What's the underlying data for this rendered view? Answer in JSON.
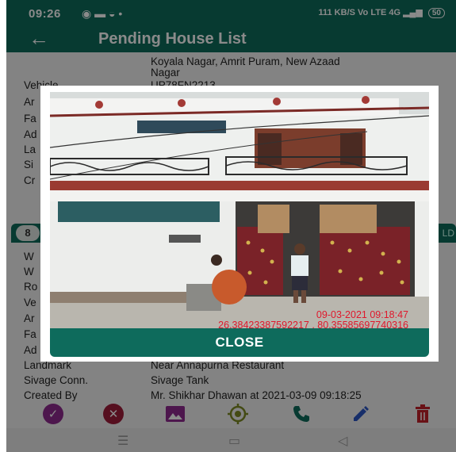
{
  "status_bar": {
    "time": "09:26",
    "net_speed": "111 KB/S",
    "network": "Vo LTE 4G",
    "battery": "50"
  },
  "app_bar": {
    "title": "Pending House List"
  },
  "record_top": {
    "address_lines": [
      "Koyala Nagar, Amrit Puram, New Azaad",
      "Nagar"
    ],
    "vehicle_label": "Vehicle",
    "vehicle_value": "UP78FN2213",
    "partial_labels": [
      "Ar",
      "Fa",
      "Ad",
      "La",
      "Si",
      "Cr"
    ]
  },
  "card": {
    "number": "8",
    "status_fragment": "LD",
    "partial_labels": [
      "W",
      "W",
      "Ro",
      "Ve",
      "Ar",
      "Fa",
      "Ad"
    ],
    "landmark_label": "Landmark",
    "landmark_value": "Near Annapurna Restaurant",
    "sivage_label": "Sivage Conn.",
    "sivage_value": "Sivage Tank",
    "created_label": "Created By",
    "created_value": "Mr. Shikhar Dhawan at 2021-03-09 09:18:25"
  },
  "dialog": {
    "stamp_datetime": "09-03-2021 09:18:47",
    "stamp_coords": "26.38423387592217 , 80.35585697740316",
    "close_label": "CLOSE"
  },
  "colors": {
    "primary": "#0e6b5c",
    "stamp_red": "#e0182c",
    "approve_purple": "#8e2a8f",
    "reject_maroon": "#a01c3a",
    "call_teal": "#0e6b5c",
    "edit_blue": "#2b56c5",
    "delete_red": "#c3202a"
  },
  "icons": [
    "approve-icon",
    "reject-icon",
    "image-icon",
    "location-icon",
    "call-icon",
    "edit-icon",
    "delete-icon"
  ]
}
